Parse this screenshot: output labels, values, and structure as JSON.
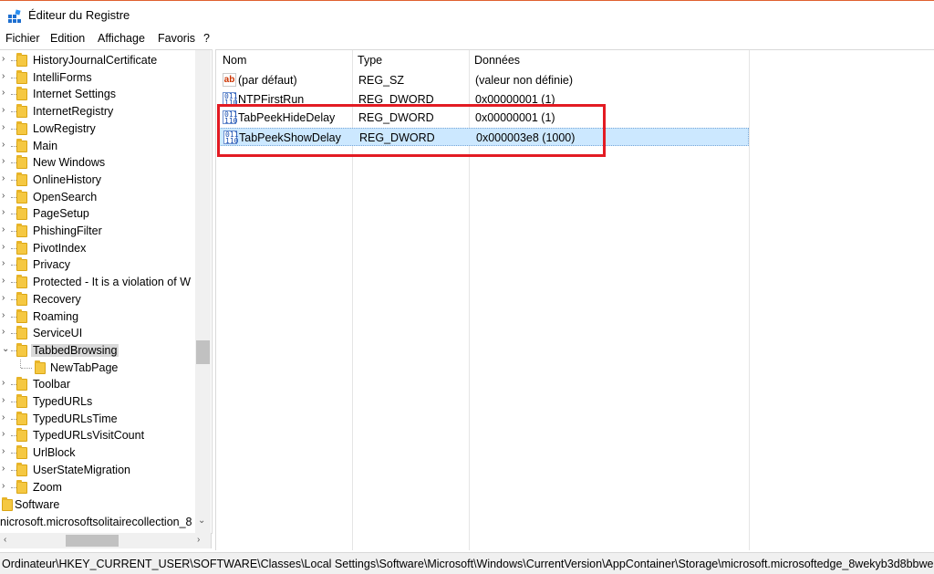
{
  "window": {
    "title": "Éditeur du Registre"
  },
  "menu": [
    "Fichier",
    "Edition",
    "Affichage",
    "Favoris",
    "?"
  ],
  "tree": {
    "items": [
      {
        "label": "HistoryJournalCertificate",
        "expander": "›"
      },
      {
        "label": "IntelliForms",
        "expander": "›"
      },
      {
        "label": "Internet Settings",
        "expander": "›"
      },
      {
        "label": "InternetRegistry",
        "expander": "›"
      },
      {
        "label": "LowRegistry",
        "expander": "›"
      },
      {
        "label": "Main",
        "expander": "›"
      },
      {
        "label": "New Windows",
        "expander": "›"
      },
      {
        "label": "OnlineHistory",
        "expander": "›"
      },
      {
        "label": "OpenSearch",
        "expander": "›"
      },
      {
        "label": "PageSetup",
        "expander": "›"
      },
      {
        "label": "PhishingFilter",
        "expander": "›"
      },
      {
        "label": "PivotIndex",
        "expander": "›"
      },
      {
        "label": "Privacy",
        "expander": "›"
      },
      {
        "label": "Protected - It is a violation of W",
        "expander": "›"
      },
      {
        "label": "Recovery",
        "expander": "›"
      },
      {
        "label": "Roaming",
        "expander": "›"
      },
      {
        "label": "ServiceUI",
        "expander": "›"
      },
      {
        "label": "TabbedBrowsing",
        "expander": "⌄",
        "selected": true
      },
      {
        "label": "NewTabPage",
        "expander": "",
        "child": true
      },
      {
        "label": "Toolbar",
        "expander": "›"
      },
      {
        "label": "TypedURLs",
        "expander": "›"
      },
      {
        "label": "TypedURLsTime",
        "expander": "›"
      },
      {
        "label": "TypedURLsVisitCount",
        "expander": "›"
      },
      {
        "label": "UrlBlock",
        "expander": "›"
      },
      {
        "label": "UserStateMigration",
        "expander": "›"
      },
      {
        "label": "Zoom",
        "expander": "›"
      }
    ],
    "software": "Software",
    "next_key": "nicrosoft.microsoftsolitairecollection_8"
  },
  "list": {
    "columns": [
      "Nom",
      "Type",
      "Données"
    ],
    "rows": [
      {
        "icon": "string-value-icon",
        "name": "(par défaut)",
        "type": "REG_SZ",
        "data": "(valeur non définie)"
      },
      {
        "icon": "dword-value-icon",
        "name": "NTPFirstRun",
        "type": "REG_DWORD",
        "data": "0x00000001 (1)"
      },
      {
        "icon": "dword-value-icon",
        "name": "TabPeekHideDelay",
        "type": "REG_DWORD",
        "data": "0x00000001 (1)"
      },
      {
        "icon": "dword-value-icon",
        "name": "TabPeekShowDelay",
        "type": "REG_DWORD",
        "data": "0x000003e8 (1000)",
        "selected": true
      }
    ]
  },
  "icons": {
    "sz_glyph": "ab",
    "dword_glyph": "011\n110"
  },
  "status": "Ordinateur\\HKEY_CURRENT_USER\\SOFTWARE\\Classes\\Local Settings\\Software\\Microsoft\\Windows\\CurrentVersion\\AppContainer\\Storage\\microsoft.microsoftedge_8wekyb3d8bbwe",
  "colors": {
    "highlight_box": "#e31b23",
    "selection": "#cce8ff",
    "folder": "#f5c842"
  }
}
